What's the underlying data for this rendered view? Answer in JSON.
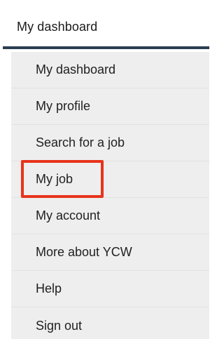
{
  "header": {
    "title": "My dashboard"
  },
  "menu": {
    "items": [
      {
        "label": "My dashboard"
      },
      {
        "label": "My profile"
      },
      {
        "label": "Search for a job"
      },
      {
        "label": "My job"
      },
      {
        "label": "My account"
      },
      {
        "label": "More about YCW"
      },
      {
        "label": "Help"
      },
      {
        "label": "Sign out"
      }
    ]
  },
  "colors": {
    "header_underline": "#2b3d51",
    "menu_background": "#eeeeee",
    "highlight": "#e8331c"
  }
}
